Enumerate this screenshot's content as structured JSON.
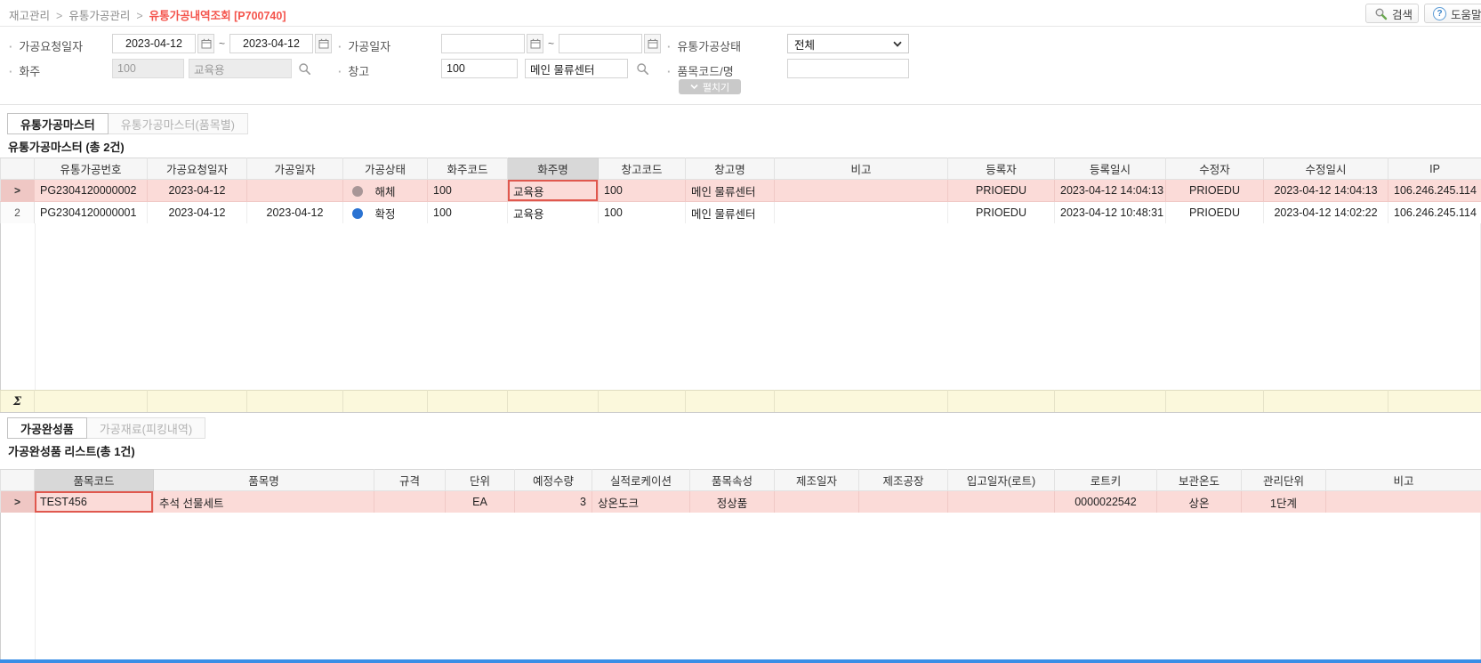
{
  "breadcrumb": {
    "items": [
      "재고관리",
      "유통가공관리"
    ],
    "separator": ">",
    "current": "유통가공내역조회 [P700740]"
  },
  "topbar": {
    "search_label": "검색",
    "help_label": "도움말",
    "help_icon": "?"
  },
  "filters": {
    "tilde": "~",
    "request_date": {
      "label": "가공요청일자",
      "from": "2023-04-12",
      "to": "2023-04-12"
    },
    "process_date": {
      "label": "가공일자",
      "from": "",
      "to": ""
    },
    "status": {
      "label": "유통가공상태",
      "value": "전체"
    },
    "shipper": {
      "label": "화주",
      "code": "100",
      "name": "교육용"
    },
    "warehouse": {
      "label": "창고",
      "code": "100",
      "name": "메인 물류센터"
    },
    "item": {
      "label": "품목코드/명",
      "value": ""
    },
    "expand_label": "펼치기"
  },
  "master": {
    "tabs": [
      {
        "label": "유통가공마스터",
        "active": true
      },
      {
        "label": "유통가공마스터(품목별)",
        "active": false
      }
    ],
    "title": "유통가공마스터 (총 2건)",
    "columns": [
      "유통가공번호",
      "가공요청일자",
      "가공일자",
      "가공상태",
      "화주코드",
      "화주명",
      "창고코드",
      "창고명",
      "비고",
      "등록자",
      "등록일시",
      "수정자",
      "수정일시",
      "IP"
    ],
    "selected_column_index": 5,
    "sum_symbol": "Σ",
    "rows": [
      {
        "indicator": ">",
        "selected": true,
        "focused_column_index": 5,
        "status_color": "#a89697",
        "cells": [
          "PG2304120000002",
          "2023-04-12",
          "",
          "해체",
          "100",
          "교육용",
          "100",
          "메인 물류센터",
          "",
          "PRIOEDU",
          "2023-04-12 14:04:13",
          "PRIOEDU",
          "2023-04-12 14:04:13",
          "106.246.245.114"
        ]
      },
      {
        "indicator": "2",
        "selected": false,
        "focused_column_index": -1,
        "status_color": "#2a73d2",
        "cells": [
          "PG2304120000001",
          "2023-04-12",
          "2023-04-12",
          "확정",
          "100",
          "교육용",
          "100",
          "메인 물류센터",
          "",
          "PRIOEDU",
          "2023-04-12 10:48:31",
          "PRIOEDU",
          "2023-04-12 14:02:22",
          "106.246.245.114"
        ]
      }
    ]
  },
  "detail": {
    "tabs": [
      {
        "label": "가공완성품",
        "active": true
      },
      {
        "label": "가공재료(피킹내역)",
        "active": false
      }
    ],
    "title": "가공완성품 리스트(총 1건)",
    "columns": [
      "품목코드",
      "품목명",
      "규격",
      "단위",
      "예정수량",
      "실적로케이션",
      "품목속성",
      "제조일자",
      "제조공장",
      "입고일자(로트)",
      "로트키",
      "보관온도",
      "관리단위",
      "비고"
    ],
    "selected_column_index": 0,
    "rows": [
      {
        "indicator": ">",
        "selected": true,
        "focused_column_index": 0,
        "status_color": "",
        "cells": [
          "TEST456",
          "추석 선물세트",
          "",
          "EA",
          "3",
          "상온도크",
          "정상품",
          "",
          "",
          "",
          "0000022542",
          "상온",
          "1단계",
          ""
        ]
      }
    ]
  },
  "colors": {
    "accent_red": "#f4544c",
    "focus_border": "#e0584e",
    "selected_row_bg": "#fbdbd8",
    "sum_row_bg": "#fbf8dc",
    "status_dismantle_dot": "#a89697",
    "status_confirmed_dot": "#2a73d2",
    "bottom_bar": "#3a8ee6"
  }
}
